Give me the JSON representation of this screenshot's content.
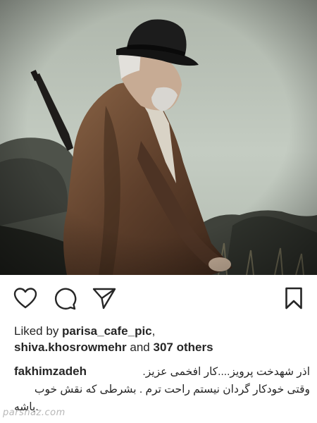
{
  "post": {
    "likes_prefix": "Liked by ",
    "liker_first": "parisa_cafe_pic",
    "liker_first_suffix": ",",
    "liker_second": "shiva.khosrowmehr",
    "likes_and": " and ",
    "others": "307 others",
    "author": "fakhimzadeh",
    "caption_line1": "اذر شهدخت پرویز....کار افخمی عزیز.",
    "caption_line2": "وقتی خودکار گردان نیستم راحت ترم . بشرطی که نقش خوب",
    "caption_line3": "باشه."
  },
  "actions": {
    "like_icon": "heart-icon",
    "comment_icon": "comment-bubble-icon",
    "share_icon": "paper-plane-icon",
    "save_icon": "bookmark-icon"
  },
  "watermark": "parsnaz.com",
  "colors": {
    "text": "#262626",
    "sky": "#b9c2b8",
    "jacket": "#6b4a34"
  }
}
